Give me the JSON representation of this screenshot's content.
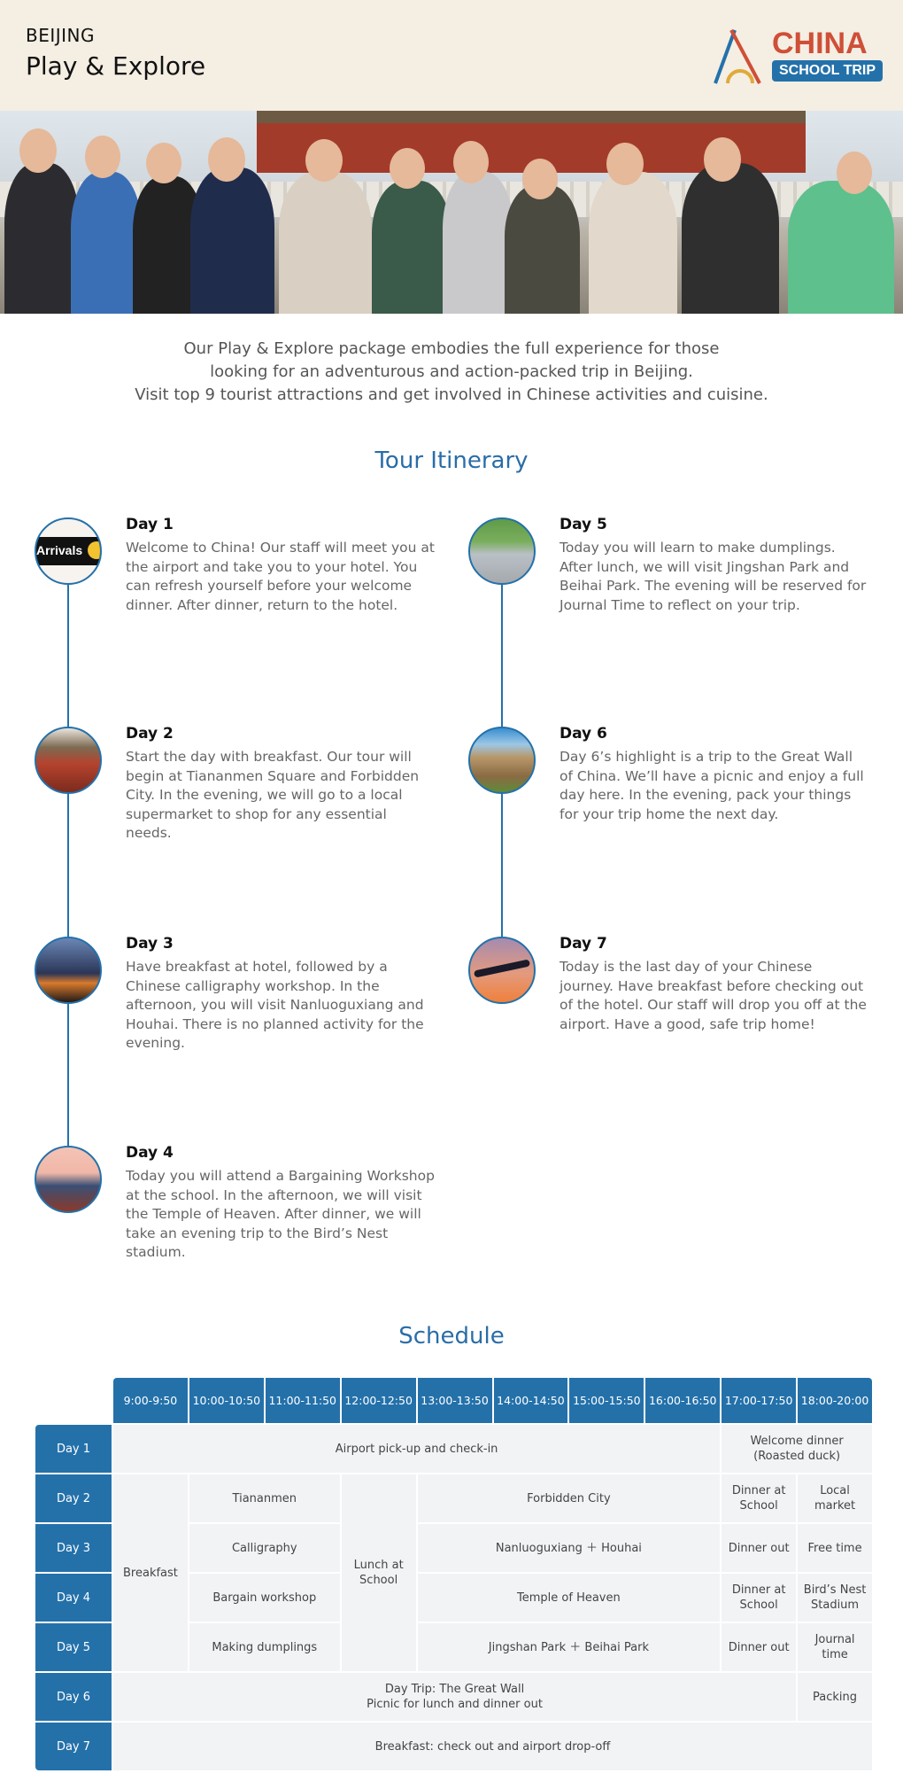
{
  "header": {
    "city": "BEIJING",
    "package": "Play & Explore",
    "logo": {
      "line1": "CHINA",
      "line2": "SCHOOL TRIP"
    }
  },
  "intro": [
    "Our Play & Explore package embodies the full experience for those",
    "looking for an adventurous and action-packed trip in Beijing.",
    "Visit top 9 tourist attractions and get involved in Chinese activities and cuisine."
  ],
  "itinerary": {
    "title": "Tour Itinerary",
    "days": [
      {
        "label": "Day 1",
        "text": "Welcome to China! Our staff will meet you at the airport and take you to your hotel. You can refresh yourself before your welcome dinner. After dinner, return to the hotel.",
        "image_text": "Arrivals"
      },
      {
        "label": "Day 2",
        "text": "Start the day with breakfast. Our tour will begin at Tiananmen Square and Forbidden City. In the evening, we will go to a local supermarket to shop for any essential needs."
      },
      {
        "label": "Day 3",
        "text": "Have breakfast at hotel, followed by a Chinese calligraphy workshop. In the afternoon, you will visit Nanluoguxiang and Houhai. There is no planned activity for the evening."
      },
      {
        "label": "Day 4",
        "text": "Today you will attend a Bargaining Workshop at the school. In the afternoon, we will visit the Temple of Heaven. After dinner, we will take an evening trip to the Bird’s Nest stadium."
      },
      {
        "label": "Day 5",
        "text": "Today you will learn to make dumplings. After lunch, we will visit Jingshan Park and Beihai Park. The evening will be reserved for Journal Time to reflect on your trip."
      },
      {
        "label": "Day 6",
        "text": "Day 6’s highlight is a trip to the Great Wall of China. We’ll have a picnic and enjoy a full day here. In the evening, pack your things for your trip home the next day."
      },
      {
        "label": "Day 7",
        "text": "Today is the last day of your Chinese journey. Have breakfast before checking out of the hotel. Our staff will drop you off at the airport. Have a good, safe trip home!"
      }
    ]
  },
  "schedule": {
    "title": "Schedule",
    "times": [
      "9:00-9:50",
      "10:00-10:50",
      "11:00-11:50",
      "12:00-12:50",
      "13:00-13:50",
      "14:00-14:50",
      "15:00-15:50",
      "16:00-16:50",
      "17:00-17:50",
      "18:00-20:00"
    ],
    "days": [
      "Day 1",
      "Day 2",
      "Day 3",
      "Day 4",
      "Day 5",
      "Day 6",
      "Day 7"
    ],
    "cells": {
      "d1_main": "Airport pick-up and check-in",
      "d1_dinner": "Welcome dinner (Roasted duck)",
      "breakfast": "Breakfast",
      "lunch": "Lunch at School",
      "d2_am": "Tiananmen",
      "d2_pm": "Forbidden City",
      "d2_dinner": "Dinner at School",
      "d2_eve": "Local market",
      "d3_am": "Calligraphy",
      "d3_pm": "Nanluoguxiang ＋ Houhai",
      "d3_dinner": "Dinner out",
      "d3_eve": "Free time",
      "d4_am": "Bargain workshop",
      "d4_pm": "Temple of Heaven",
      "d4_dinner": "Dinner at School",
      "d4_eve": "Bird’s Nest Stadium",
      "d5_am": "Making dumplings",
      "d5_pm": "Jingshan Park ＋ Beihai Park",
      "d5_dinner": "Dinner out",
      "d5_eve": "Journal time",
      "d6_main_1": "Day Trip: The Great Wall",
      "d6_main_2": "Picnic for lunch and dinner out",
      "d6_eve": "Packing",
      "d7_main": "Breakfast: check out and airport drop-off"
    }
  },
  "colors": {
    "brand_blue": "#2471aa",
    "brand_red": "#cf4f37",
    "header_bg": "#f4eee3"
  }
}
